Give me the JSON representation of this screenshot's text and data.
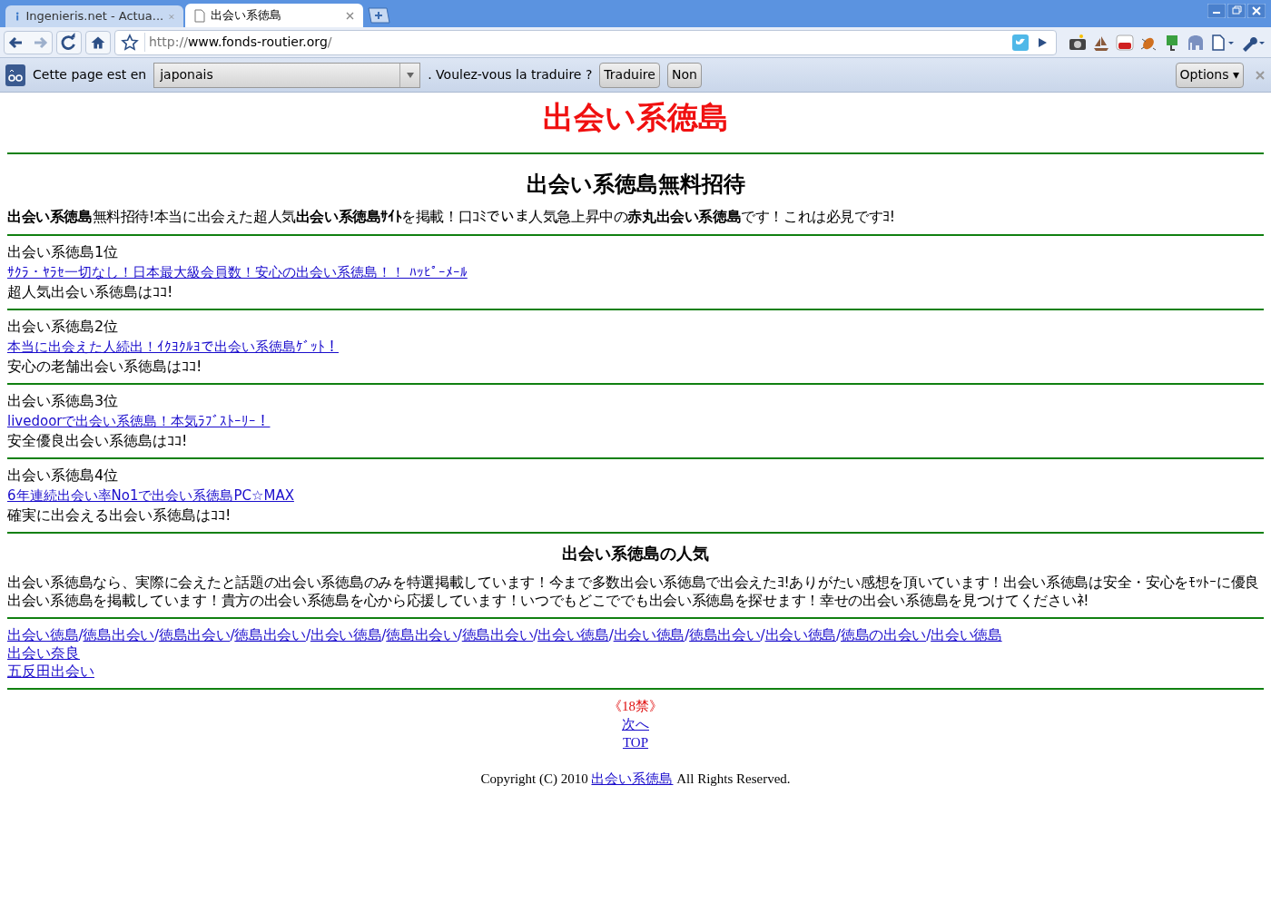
{
  "tabs": [
    {
      "title": "Ingenieris.net - Actua...",
      "kind": "info",
      "selected": false
    },
    {
      "title": "出会い系徳島",
      "kind": "page",
      "selected": true
    }
  ],
  "address": {
    "scheme": "http://",
    "host": "www.fonds-routier.org",
    "path": "/"
  },
  "translate_bar": {
    "prefix": "Cette page est en",
    "language": "japonais",
    "question": ". Voulez-vous la traduire ?",
    "buttons": [
      "Traduire",
      "Non"
    ],
    "options": "Options ▾"
  },
  "page": {
    "title": "出会い系徳島",
    "heading": "出会い系徳島無料招待",
    "intro": "**出会い系徳島**無料招待!本当に出会えた超人気**出会い系徳島ｻｲﾄ**を掲載！口ｺﾐでいま人気急上昇中の**赤丸出会い系徳島**です！これは必見ですﾖ!",
    "rankings": [
      {
        "rank": "出会い系徳島1位",
        "link": "ｻｸﾗ・ﾔﾗｾ一切なし！日本最大級会員数！安心の出会い系徳島！！ ﾊｯﾋﾟｰﾒｰﾙ",
        "note": "超人気出会い系徳島はｺｺ!"
      },
      {
        "rank": "出会い系徳島2位",
        "link": "本当に出会えた人続出！ｲｸﾖｸﾙﾖで出会い系徳島ｹﾞｯﾄ！",
        "note": "安心の老舗出会い系徳島はｺｺ!"
      },
      {
        "rank": "出会い系徳島3位",
        "link": "livedoorで出会い系徳島！本気ﾗﾌﾞｽﾄｰﾘｰ！",
        "note": "安全優良出会い系徳島はｺｺ!"
      },
      {
        "rank": "出会い系徳島4位",
        "link": "6年連続出会い率No1で出会い系徳島PC☆MAX",
        "note": "確実に出会える出会い系徳島はｺｺ!"
      }
    ],
    "popular_heading": "出会い系徳島の人気",
    "popular_text": "出会い系徳島なら、実際に会えたと話題の出会い系徳島のみを特選掲載しています！今まで多数出会い系徳島で出会えたﾖ!ありがたい感想を頂いています！出会い系徳島は安全・安心をﾓｯﾄｰに優良出会い系徳島を掲載しています！貴方の出会い系徳島を心から応援しています！いつでもどこででも出会い系徳島を探せます！幸せの出会い系徳島を見つけてくださいﾈ!",
    "keyword_links": [
      "出会い徳島",
      "徳島出会い",
      "徳島出会い",
      "徳島出会い",
      "出会い徳島",
      "徳島出会い",
      "徳島出会い",
      "出会い徳島",
      "出会い徳島",
      "徳島出会い",
      "出会い徳島",
      "徳島の出会い",
      "出会い徳島"
    ],
    "separator": "/",
    "other_links": [
      "出会い奈良",
      "五反田出会い"
    ],
    "age_notice": "《18禁》",
    "next": "次へ",
    "top": "TOP",
    "copyright": {
      "before": "Copyright (C) 2010",
      "link": "出会い系徳島",
      "after": "All Rights Reserved."
    }
  }
}
